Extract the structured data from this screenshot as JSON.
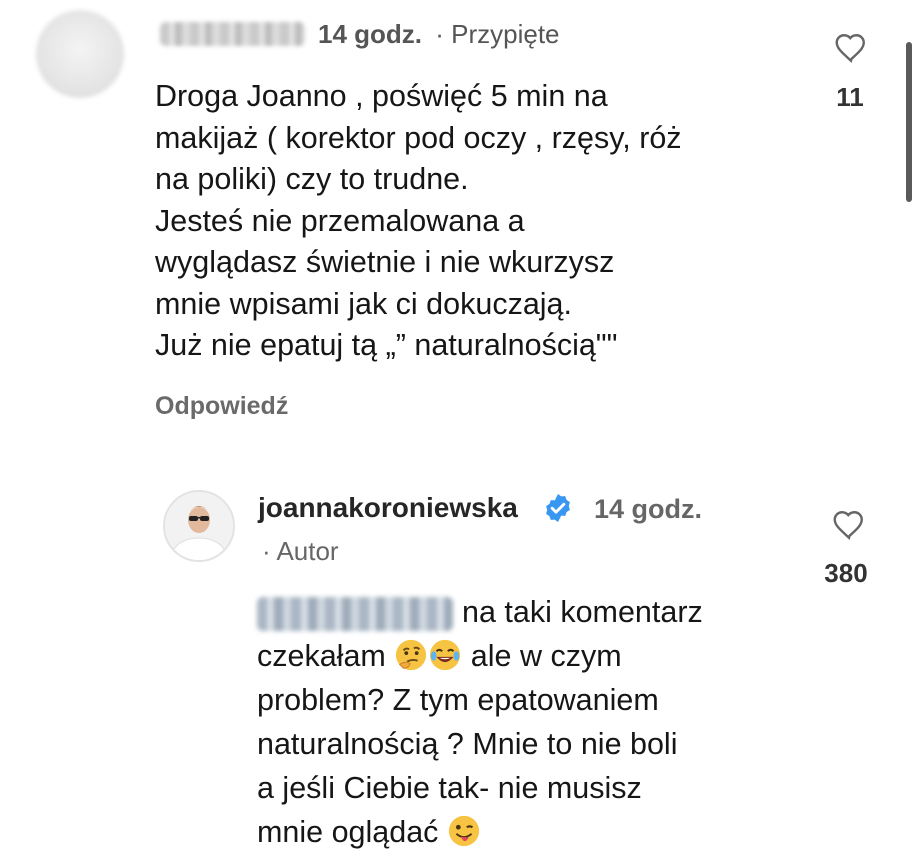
{
  "comment": {
    "time": "14 godz.",
    "pinned": "· Przypięte",
    "text": "Droga Joanno , poświęć 5 min na\nmakijaż ( korektor pod oczy , rzęsy, róż\nna poliki) czy to trudne.\nJesteś nie przemalowana  a\nwyglądasz świetnie i nie wkurzysz\nmnie wpisami jak ci dokuczają.\nJuż nie epatuj tą „” naturalnością\"\"",
    "reply_label": "Odpowiedź",
    "likes": "11"
  },
  "reply": {
    "username": "joannakoroniewska",
    "time": "14 godz.",
    "author": "· Autor",
    "likes": "380",
    "line1": "na taki komentarz",
    "line2_a": "czekałam",
    "line2_b": "ale w czym",
    "line3": "problem? Z tym epatowaniem",
    "line4": "naturalnością ? Mnie to nie boli",
    "line5": "a jeśli Ciebie tak- nie musisz",
    "line6": "mnie oglądać"
  },
  "icons": {
    "heart": "heart-outline-icon",
    "verified": "verified-badge-icon",
    "emoji_thinking": "thinking-face-icon",
    "emoji_laugh": "tears-of-joy-icon",
    "emoji_wink": "winking-tongue-face-icon"
  },
  "colors": {
    "verified": "#3897f0",
    "emoji": "#f6c343"
  }
}
